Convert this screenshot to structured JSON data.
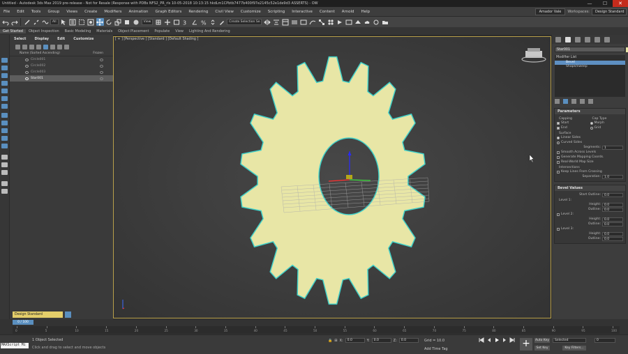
{
  "window": {
    "title": "Untitled - Autodesk 3ds Max 2019 pre-release - Not for Resale (Response with PDBs NFS2_PR_rls 10-05-2018 10:13:15 hkdLm1CPbtb7477b400f97e2145c52e1de9d3 ASSERTS) - OW",
    "minimize": "—",
    "maximize": "☐",
    "close": "✕"
  },
  "menu": {
    "items": [
      "File",
      "Edit",
      "Tools",
      "Group",
      "Views",
      "Create",
      "Modifiers",
      "Animation",
      "Graph Editors",
      "Rendering",
      "Civil View",
      "Customize",
      "Scripting",
      "Interactive",
      "Content",
      "Arnold",
      "Help"
    ],
    "user": "Amador Vale",
    "workspaces_label": "Workspaces:",
    "workspace": "Design Standard"
  },
  "toolbar": {
    "selection_filter": "All",
    "ref_coord": "View",
    "named_selection": "Create Selection Se"
  },
  "ribbon": {
    "tabs": [
      "Get Started",
      "Object Inspection",
      "Basic Modeling",
      "Materials",
      "Object Placement",
      "Populate",
      "View",
      "Lighting And Rendering"
    ]
  },
  "scene_explorer": {
    "menu": [
      "Select",
      "Display",
      "Edit",
      "Customize"
    ],
    "col_name": "Name (Sorted Ascending)",
    "col_frozen": "Frozen",
    "rows": [
      {
        "name": "Circle001",
        "selected": false
      },
      {
        "name": "Circle002",
        "selected": false
      },
      {
        "name": "Circle003",
        "selected": false
      },
      {
        "name": "Star001",
        "selected": true
      }
    ],
    "layer": "Design Standard"
  },
  "viewport": {
    "label": "[ + ] [Perspective ] [Standard ] [Default Shading ]"
  },
  "command_panel": {
    "object_name": "Star001",
    "object_color": "#e8e6a6",
    "modifier_list": "Modifier List",
    "stack": [
      "Bevel",
      "Shape/sweep"
    ],
    "parameters": {
      "title": "Parameters",
      "capping": "Capping",
      "cap_type": "Cap Type",
      "start": "Start",
      "end": "End",
      "morph": "Morph",
      "grid": "Grid",
      "surface": "Surface",
      "linear_sides": "Linear Sides",
      "curved_sides": "Curved Sides",
      "segments_label": "Segments:",
      "segments": "1",
      "smooth_across": "Smooth Across Levels",
      "gen_mapping": "Generate Mapping Coords.",
      "real_world": "Real-World Map Size",
      "intersections": "Intersections",
      "keep_lines": "Keep Lines From Crossing",
      "separation_label": "Separation:",
      "separation": "1.0"
    },
    "bevel_values": {
      "title": "Bevel Values",
      "start_outline_label": "Start Outline:",
      "start_outline": "0.0",
      "level1": "Level 1:",
      "level2": "Level 2:",
      "level3": "Level 3:",
      "height_label": "Height:",
      "outline_label": "Outline:",
      "level1_height": "0.0",
      "level1_outline": "0.0",
      "level2_height": "0.0",
      "level2_outline": "0.0",
      "level3_height": "0.0",
      "level3_outline": "0.0"
    }
  },
  "timeline": {
    "slider": "0 / 100",
    "ticks": [
      "0",
      "5",
      "10",
      "15",
      "20",
      "25",
      "30",
      "35",
      "40",
      "45",
      "50",
      "55",
      "60",
      "65",
      "70",
      "75",
      "80",
      "85",
      "90",
      "95",
      "100"
    ]
  },
  "status": {
    "maxscript": "MAXScript Mi",
    "objects_selected": "1 Object Selected",
    "prompt": "Click and drag to select and move objects",
    "x_label": "X:",
    "y_label": "Y:",
    "z_label": "Z:",
    "x": "0.0",
    "y": "0.0",
    "z": "0.0",
    "grid": "Grid = 10.0",
    "add_time_tag": "Add Time Tag",
    "auto_key": "Auto Key",
    "set_key": "Set Key",
    "selected": "Selected",
    "key_filters": "Key Filters...",
    "frame": "0"
  }
}
